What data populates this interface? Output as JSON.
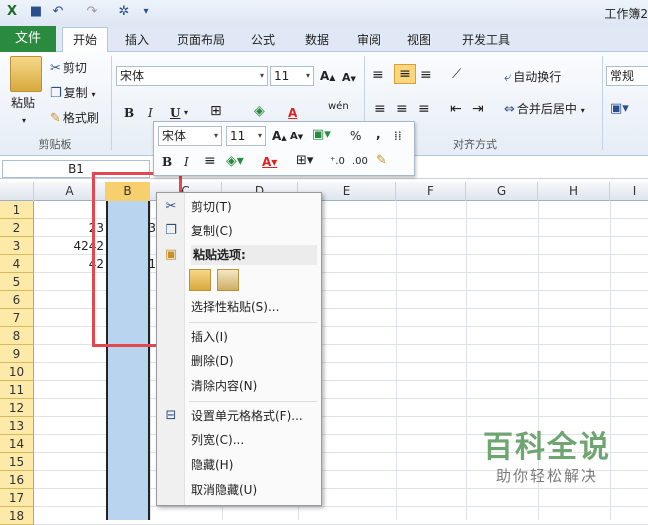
{
  "titlebar": {
    "title": "工作簿2"
  },
  "tabs": {
    "file": "文件",
    "items": [
      "开始",
      "插入",
      "页面布局",
      "公式",
      "数据",
      "审阅",
      "视图",
      "开发工具"
    ]
  },
  "clipboard": {
    "paste": "粘贴",
    "cut": "剪切",
    "copy": "复制",
    "format_painter": "格式刷",
    "group": "剪贴板"
  },
  "font": {
    "name": "宋体",
    "size": "11",
    "bold": "B",
    "italic": "I",
    "underline": "U",
    "grow": "A",
    "shrink": "A",
    "font_color": "A",
    "phonetic": "wén"
  },
  "alignment": {
    "wrap": "自动换行",
    "merge": "合并后居中",
    "group": "对齐方式"
  },
  "number": {
    "format": "常规"
  },
  "formula_bar": {
    "name_box": "B1"
  },
  "columns": [
    "A",
    "B",
    "C",
    "D",
    "E",
    "F",
    "G",
    "H",
    "I"
  ],
  "rows": [
    "1",
    "2",
    "3",
    "4",
    "5",
    "6",
    "7",
    "8",
    "9",
    "10",
    "11",
    "12",
    "13",
    "14",
    "15",
    "16",
    "17",
    "18"
  ],
  "cells": {
    "a2": "23",
    "a3": "4242",
    "a4": "42",
    "b2": "3",
    "b4": "1"
  },
  "mini_toolbar": {
    "font": "宋体",
    "size": "11",
    "bold": "B",
    "italic": "I",
    "percent": "%",
    "comma": ","
  },
  "context_menu": {
    "cut": "剪切(T)",
    "copy": "复制(C)",
    "paste_options": "粘贴选项:",
    "paste_special": "选择性粘贴(S)...",
    "insert": "插入(I)",
    "delete": "删除(D)",
    "clear": "清除内容(N)",
    "format_cells": "设置单元格格式(F)...",
    "col_width": "列宽(C)...",
    "hide": "隐藏(H)",
    "unhide": "取消隐藏(U)"
  },
  "watermark": {
    "title": "百科全说",
    "subtitle": "助你轻松解决"
  },
  "colors": {
    "file_tab": "#2a8a3e",
    "selection": "#b9d4ef",
    "highlight": "#e3474f",
    "row_header": "#fde9a8"
  }
}
